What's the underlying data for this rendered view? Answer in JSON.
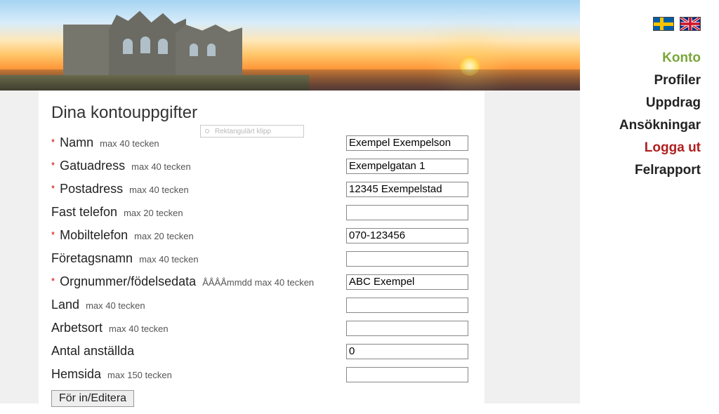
{
  "page_title": "Dina kontouppgifter",
  "snip_label": "Rektangulärt klipp",
  "fields": {
    "name": {
      "label": "Namn",
      "hint": "max 40 tecken",
      "required": true,
      "value": "Exempel Exempelson"
    },
    "street": {
      "label": "Gatuadress",
      "hint": "max 40 tecken",
      "required": true,
      "value": "Exempelgatan 1"
    },
    "postal": {
      "label": "Postadress",
      "hint": "max 40 tecken",
      "required": true,
      "value": "12345 Exempelstad"
    },
    "phone": {
      "label": "Fast telefon",
      "hint": "max 20 tecken",
      "required": false,
      "value": ""
    },
    "mobile": {
      "label": "Mobiltelefon",
      "hint": "max 20 tecken",
      "required": true,
      "value": "070-123456"
    },
    "company": {
      "label": "Företagsnamn",
      "hint": "max 40 tecken",
      "required": false,
      "value": ""
    },
    "orgnr": {
      "label": "Orgnummer/födelsedata",
      "hint": "ÅÅÅÅmmdd max 40 tecken",
      "required": true,
      "value": "ABC Exempel"
    },
    "country": {
      "label": "Land",
      "hint": "max 40 tecken",
      "required": false,
      "value": ""
    },
    "workplace": {
      "label": "Arbetsort",
      "hint": "max 40 tecken",
      "required": false,
      "value": ""
    },
    "employees": {
      "label": "Antal anställda",
      "hint": "",
      "required": false,
      "value": "0"
    },
    "website": {
      "label": "Hemsida",
      "hint": "max 150 tecken",
      "required": false,
      "value": ""
    }
  },
  "submit_label": "För in/Editera",
  "nav": {
    "konto": "Konto",
    "profiler": "Profiler",
    "uppdrag": "Uppdrag",
    "ansokningar": "Ansökningar",
    "logga_ut": "Logga ut",
    "felrapport": "Felrapport"
  },
  "flags": {
    "se": "swedish-flag",
    "uk": "uk-flag"
  }
}
